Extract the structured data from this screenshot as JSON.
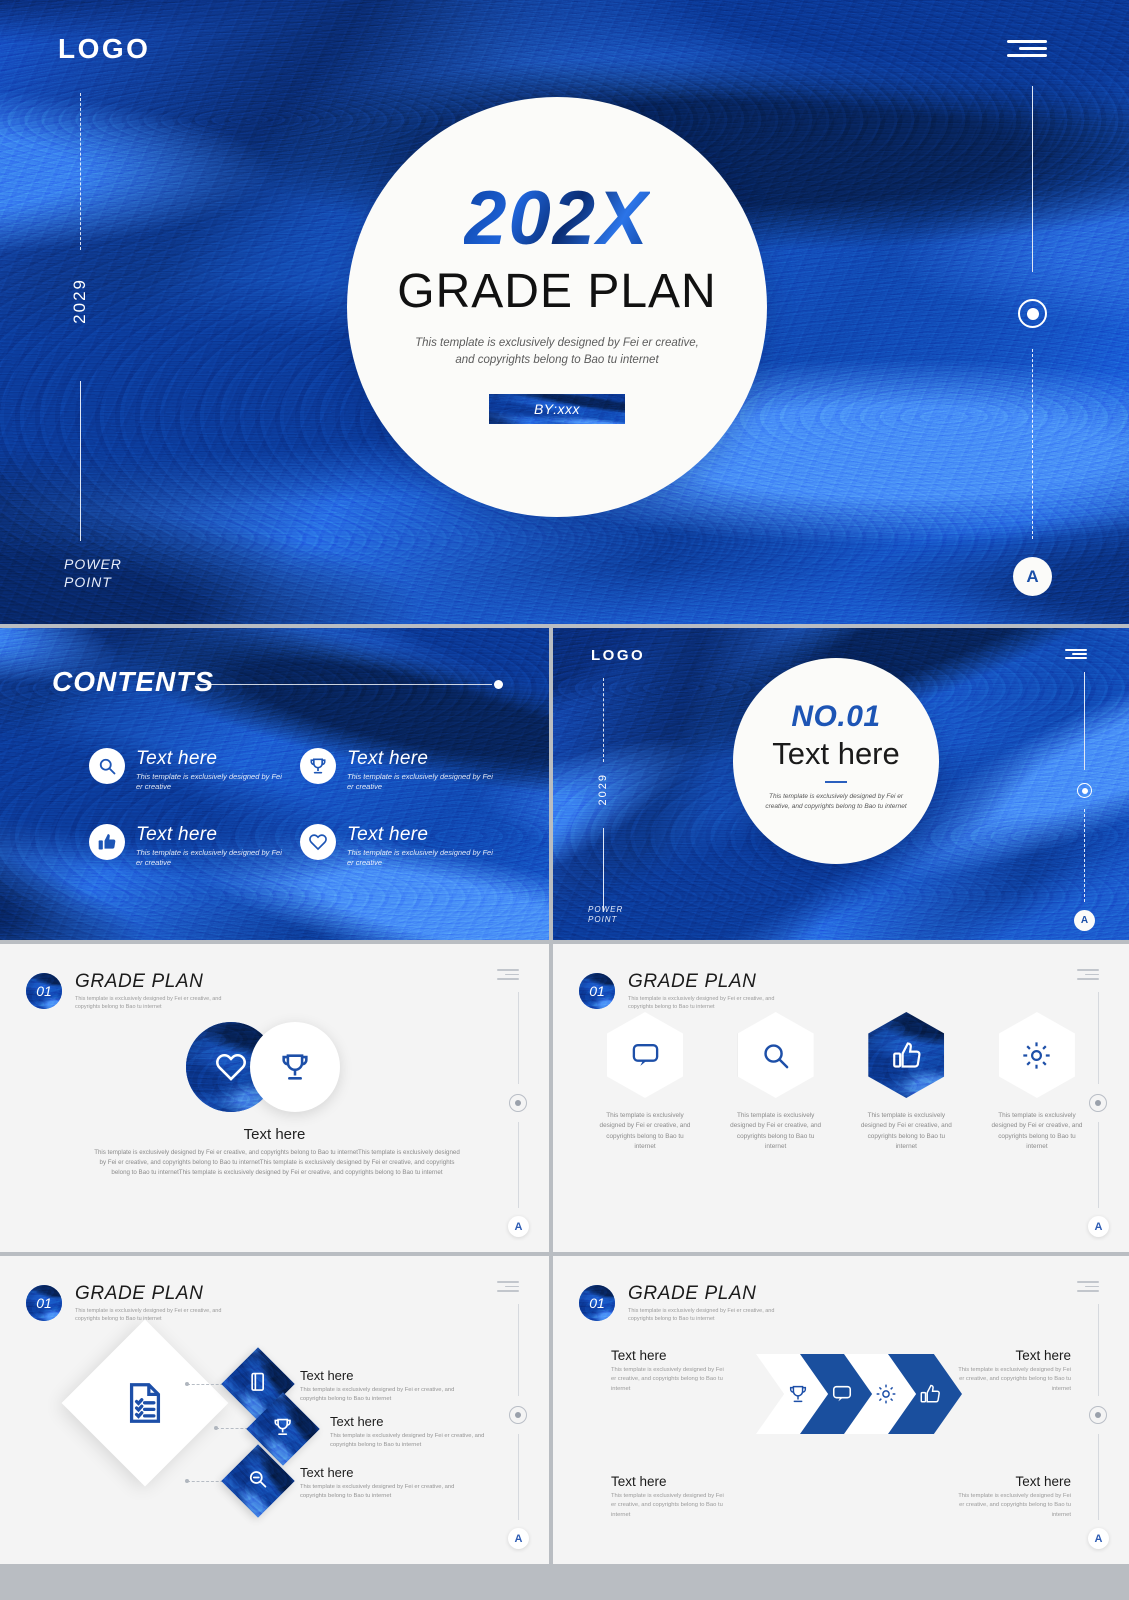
{
  "brand": {
    "accent": "#1d55b5",
    "deep_blue": "#103f96",
    "light_bg": "#f4f4f4"
  },
  "common": {
    "logo": "LOGO",
    "year": "2029",
    "power": "POWER",
    "point": "POINT",
    "a_badge": "A",
    "text_here": "Text here",
    "blurb_short": "This template is exclusively designed by Fei er creative",
    "blurb_medium": "This template is exclusively designed by Fei er creative, and copyrights belong to Bao tu internet",
    "blurb_hex": "This template is exclusively designed by Fei er creative, and copyrights belong to Bao tu internet",
    "header_title": "GRADE PLAN",
    "header_number": "01",
    "header_sub": "This template is exclusively designed by Fei er creative, and copyrights belong to Bao tu internet"
  },
  "hero": {
    "logo": "LOGO",
    "year_vertical": "2029",
    "power": "POWER",
    "point": "POINT",
    "title_year": "202X",
    "title_main": "GRADE PLAN",
    "subtitle": "This template is exclusively designed by Fei er creative, and copyrights belong to Bao tu internet",
    "by_label": "BY:xxx",
    "a_badge": "A"
  },
  "contents": {
    "title": "CONTENTS",
    "items": [
      {
        "icon": "search-icon",
        "label": "Text here",
        "desc": "This template is exclusively designed by Fei er creative"
      },
      {
        "icon": "trophy-icon",
        "label": "Text here",
        "desc": "This template is exclusively designed by Fei er creative"
      },
      {
        "icon": "thumbs-up-icon",
        "label": "Text here",
        "desc": "This template is exclusively designed by Fei er creative"
      },
      {
        "icon": "heart-icon",
        "label": "Text here",
        "desc": "This template is exclusively designed by Fei er creative"
      }
    ]
  },
  "section": {
    "logo": "LOGO",
    "year_vertical": "2029",
    "power": "POWER",
    "point": "POINT",
    "number": "NO.01",
    "title": "Text here",
    "subtitle": "This template is exclusively designed by Fei er creative, and copyrights belong to Bao tu internet",
    "a_badge": "A"
  },
  "slide_circles": {
    "number": "01",
    "title": "GRADE PLAN",
    "header_sub": "This template is exclusively designed by Fei er creative, and copyrights belong to Bao tu internet",
    "icon_left": "heart-icon",
    "icon_right": "trophy-icon",
    "caption": "Text here",
    "paragraph": "This template is exclusively designed by Fei er creative, and copyrights belong to Bao tu internetThis template is exclusively designed by Fei er creative, and copyrights belong to Bao tu internetThis template is exclusively designed by Fei er creative, and copyrights belong to Bao tu internetThis template is exclusively designed by Fei er creative, and copyrights belong to Bao tu internet",
    "a_badge": "A"
  },
  "slide_hexagons": {
    "number": "01",
    "title": "GRADE PLAN",
    "header_sub": "This template is exclusively designed by Fei er creative, and copyrights belong to Bao tu internet",
    "items": [
      {
        "icon": "chat-icon",
        "highlight": false,
        "desc": "This template is exclusively designed by Fei er creative, and copyrights belong to Bao tu internet"
      },
      {
        "icon": "search-icon",
        "highlight": false,
        "desc": "This template is exclusively designed by Fei er creative, and copyrights belong to Bao tu internet"
      },
      {
        "icon": "thumbs-up-icon",
        "highlight": true,
        "desc": "This template is exclusively designed by Fei er creative, and copyrights belong to Bao tu internet"
      },
      {
        "icon": "gear-icon",
        "highlight": false,
        "desc": "This template is exclusively designed by Fei er creative, and copyrights belong to Bao tu internet"
      }
    ],
    "a_badge": "A"
  },
  "slide_diamonds": {
    "number": "01",
    "title": "GRADE PLAN",
    "header_sub": "This template is exclusively designed by Fei er creative, and copyrights belong to Bao tu internet",
    "center_icon": "checklist-document-icon",
    "items": [
      {
        "icon": "book-icon",
        "label": "Text here",
        "desc": "This template is exclusively designed by Fei er creative, and copyrights belong to Bao tu internet"
      },
      {
        "icon": "trophy-icon",
        "label": "Text here",
        "desc": "This template is exclusively designed by Fei er creative, and copyrights belong to Bao tu internet"
      },
      {
        "icon": "zoom-out-icon",
        "label": "Text here",
        "desc": "This template is exclusively designed by Fei er creative, and copyrights belong to Bao tu internet"
      }
    ],
    "a_badge": "A"
  },
  "slide_arrows": {
    "number": "01",
    "title": "GRADE PLAN",
    "header_sub": "This template is exclusively designed by Fei er creative, and copyrights belong to Bao tu internet",
    "chevrons": [
      {
        "icon": "trophy-icon",
        "style": "white"
      },
      {
        "icon": "chat-icon",
        "style": "blue"
      },
      {
        "icon": "gear-icon",
        "style": "white"
      },
      {
        "icon": "thumbs-up-icon",
        "style": "blue"
      }
    ],
    "corners": [
      {
        "label": "Text here",
        "desc": "This template is exclusively designed by Fei er creative, and copyrights belong to Bao tu internet"
      },
      {
        "label": "Text here",
        "desc": "This template is exclusively designed by Fei er creative, and copyrights belong to Bao tu internet"
      },
      {
        "label": "Text here",
        "desc": "This template is exclusively designed by Fei er creative, and copyrights belong to Bao tu internet"
      },
      {
        "label": "Text here",
        "desc": "This template is exclusively designed by Fei er creative, and copyrights belong to Bao tu internet"
      }
    ],
    "a_badge": "A"
  }
}
